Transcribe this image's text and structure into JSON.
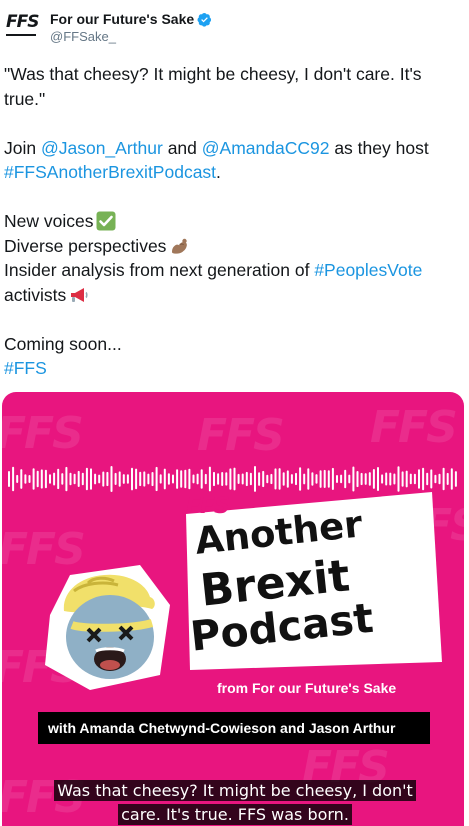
{
  "account": {
    "display_name": "For our Future's Sake",
    "handle": "@FFSake_",
    "avatar_text": "FFS",
    "verified": true
  },
  "tweet": {
    "line1": "\"Was that cheesy? It might be cheesy, I don't care. It's",
    "line2": "true.\"",
    "join_pre": "Join ",
    "mention1": "@Jason_Arthur",
    "join_mid": " and ",
    "mention2": "@AmandaCC92",
    "join_post": " as they host",
    "hashtag_podcast": "#FFSAnotherBrexitPodcast",
    "period": ".",
    "item1": "New voices",
    "item2": "Diverse perspectives",
    "item3_pre": "Insider analysis from next generation of ",
    "hashtag_peoplesvote": "#PeoplesVote",
    "item3_post": "activists",
    "coming_soon": "Coming soon...",
    "hashtag_ffs": "#FFS",
    "emoji_icons": [
      "check-mark-button",
      "flexed-biceps",
      "megaphone"
    ]
  },
  "media": {
    "logo_text": "FFS",
    "title_line1": "Another",
    "title_line2": "Brexit",
    "title_line3": "Podcast",
    "from_line": "from For our Future's Sake",
    "with_line": "with Amanda Chetwynd-Cowieson and Jason Arthur",
    "caption_line1": "Was that cheesy? It might be cheesy, I don't",
    "caption_line2": "care. It's true. FFS was born.",
    "colors": {
      "background": "#e8157f",
      "link": "#1b95e0",
      "verified": "#1da1f2"
    }
  }
}
